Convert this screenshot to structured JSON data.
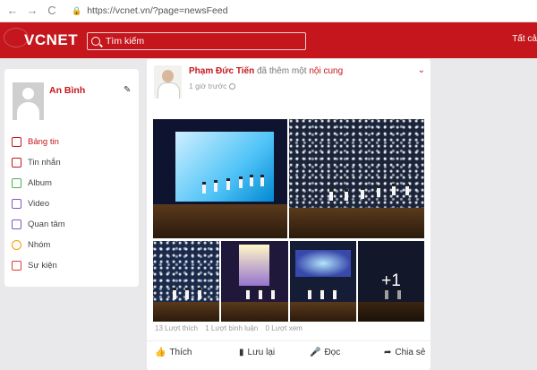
{
  "browser": {
    "back": "←",
    "forward": "→",
    "reload": "C",
    "url": "https://vcnet.vn/?page=newsFeed"
  },
  "header": {
    "logo": "VCNET",
    "search_placeholder": "Tìm kiếm",
    "right_text": "Tất cả",
    "brand_color": "#c4161c"
  },
  "sidebar": {
    "user_name": "An Bình",
    "items": [
      {
        "label": "Bảng tin",
        "icon": "newsfeed-icon",
        "color": "#c4161c",
        "active": true
      },
      {
        "label": "Tin nhắn",
        "icon": "message-icon",
        "color": "#c4161c"
      },
      {
        "label": "Album",
        "icon": "album-icon",
        "color": "#4caf50"
      },
      {
        "label": "Video",
        "icon": "video-icon",
        "color": "#7e57c2"
      },
      {
        "label": "Quan tâm",
        "icon": "follow-icon",
        "color": "#7e57c2"
      },
      {
        "label": "Nhóm",
        "icon": "group-icon",
        "color": "#ff9800"
      },
      {
        "label": "Sự kiện",
        "icon": "calendar-icon",
        "color": "#e53935"
      }
    ]
  },
  "post": {
    "author": "Phạm Đức Tiến",
    "action": "đã thêm một",
    "object": "nội cung",
    "time": "1 giờ trước",
    "more_count": "+1",
    "stats": {
      "likes": "13 Lượt thích",
      "comments": "1 Lượt bình luận",
      "views": "0 Lượt xem"
    },
    "actions": {
      "like": "Thích",
      "save": "Lưu lại",
      "read": "Đọc",
      "share": "Chia sẻ"
    }
  }
}
